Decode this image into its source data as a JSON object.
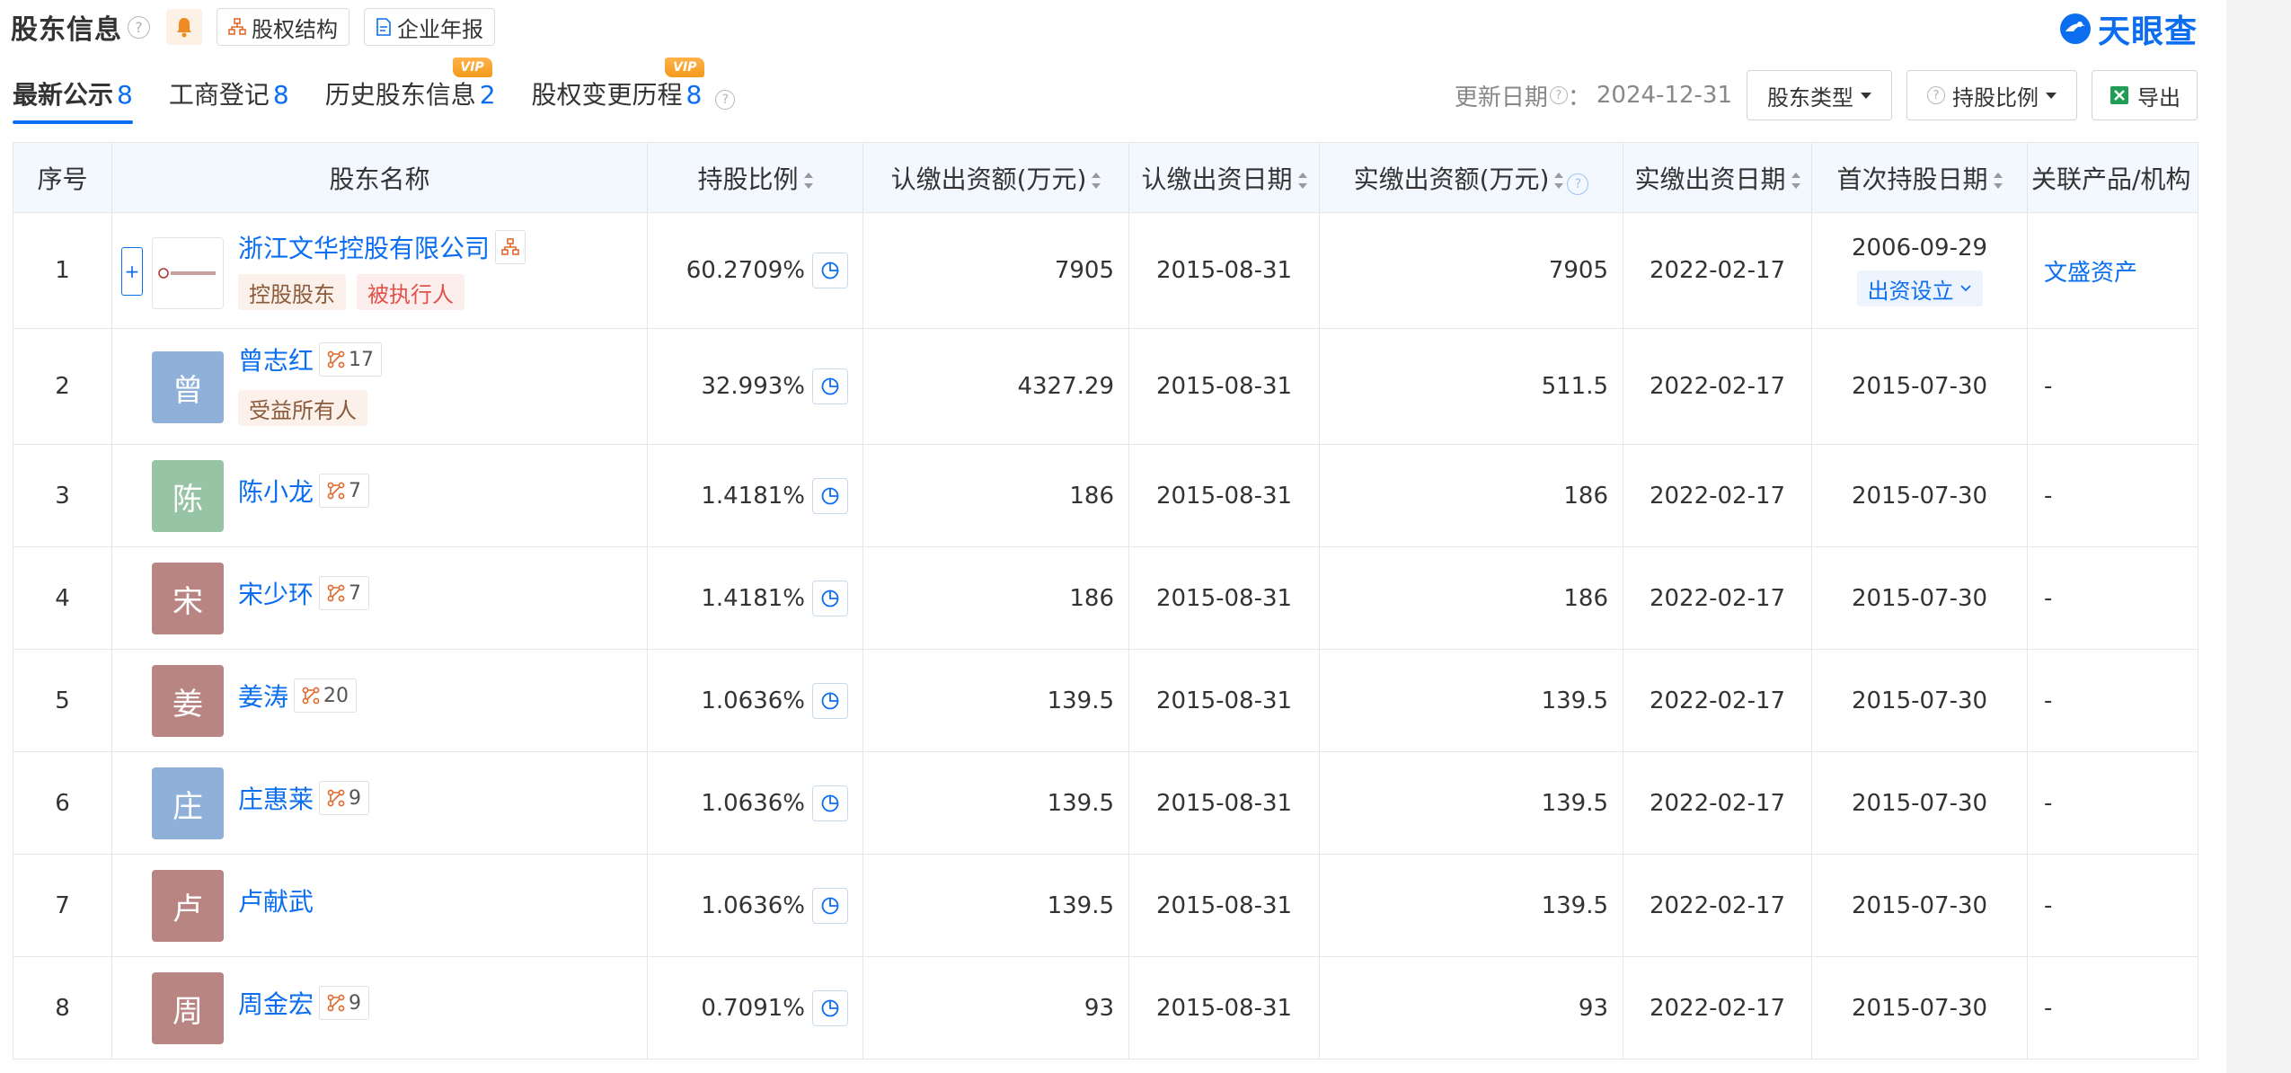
{
  "header": {
    "title": "股东信息",
    "help_mark": "?",
    "equity_structure_label": "股权结构",
    "annual_report_label": "企业年报",
    "logo_text": "天眼查"
  },
  "tabs": [
    {
      "label": "最新公示",
      "count": "8",
      "active": true
    },
    {
      "label": "工商登记",
      "count": "8",
      "active": false
    },
    {
      "label": "历史股东信息",
      "count": "2",
      "vip": "VIP"
    },
    {
      "label": "股权变更历程",
      "count": "8",
      "vip": "VIP",
      "help": "?"
    }
  ],
  "toolbar": {
    "update_label": "更新日期",
    "update_separator": "：",
    "update_date": "2024-12-31",
    "type_filter_label": "股东类型",
    "ratio_filter_label": "持股比例",
    "export_label": "导出"
  },
  "table": {
    "headers": [
      "序号",
      "股东名称",
      "持股比例",
      "认缴出资额(万元)",
      "认缴出资日期",
      "实缴出资额(万元)",
      "实缴出资日期",
      "首次持股日期",
      "关联产品/机构"
    ],
    "rows": [
      {
        "no": "1",
        "name": "浙江文华控股有限公司",
        "avatar": "",
        "tags": [
          "控股股东",
          "被执行人"
        ],
        "ratio": "60.2709%",
        "subscribed": "7905",
        "subscribed_date": "2015-08-31",
        "paid": "7905",
        "paid_date": "2022-02-17",
        "first_date": "2006-09-29",
        "first_action": "出资设立",
        "related": "文盛资产"
      },
      {
        "no": "2",
        "name": "曾志红",
        "avatar": "曾",
        "badge": "17",
        "tags": [
          "受益所有人"
        ],
        "ratio": "32.993%",
        "subscribed": "4327.29",
        "subscribed_date": "2015-08-31",
        "paid": "511.5",
        "paid_date": "2022-02-17",
        "first_date": "2015-07-30",
        "related": "-"
      },
      {
        "no": "3",
        "name": "陈小龙",
        "avatar": "陈",
        "badge": "7",
        "ratio": "1.4181%",
        "subscribed": "186",
        "subscribed_date": "2015-08-31",
        "paid": "186",
        "paid_date": "2022-02-17",
        "first_date": "2015-07-30",
        "related": "-"
      },
      {
        "no": "4",
        "name": "宋少环",
        "avatar": "宋",
        "badge": "7",
        "ratio": "1.4181%",
        "subscribed": "186",
        "subscribed_date": "2015-08-31",
        "paid": "186",
        "paid_date": "2022-02-17",
        "first_date": "2015-07-30",
        "related": "-"
      },
      {
        "no": "5",
        "name": "姜涛",
        "avatar": "姜",
        "badge": "20",
        "ratio": "1.0636%",
        "subscribed": "139.5",
        "subscribed_date": "2015-08-31",
        "paid": "139.5",
        "paid_date": "2022-02-17",
        "first_date": "2015-07-30",
        "related": "-"
      },
      {
        "no": "6",
        "name": "庄惠莱",
        "avatar": "庄",
        "badge": "9",
        "ratio": "1.0636%",
        "subscribed": "139.5",
        "subscribed_date": "2015-08-31",
        "paid": "139.5",
        "paid_date": "2022-02-17",
        "first_date": "2015-07-30",
        "related": "-"
      },
      {
        "no": "7",
        "name": "卢献武",
        "avatar": "卢",
        "ratio": "1.0636%",
        "subscribed": "139.5",
        "subscribed_date": "2015-08-31",
        "paid": "139.5",
        "paid_date": "2022-02-17",
        "first_date": "2015-07-30",
        "related": "-"
      },
      {
        "no": "8",
        "name": "周金宏",
        "avatar": "周",
        "badge": "9",
        "ratio": "0.7091%",
        "subscribed": "93",
        "subscribed_date": "2015-08-31",
        "paid": "93",
        "paid_date": "2022-02-17",
        "first_date": "2015-07-30",
        "related": "-"
      }
    ]
  },
  "colors": {
    "brand_blue": "#0b6ef0",
    "avatar_blue": "#8fb0d8",
    "avatar_green": "#96c4a4",
    "avatar_rose": "#b98583"
  },
  "icons": {
    "bell": "bell-icon",
    "equity": "org-chart-icon",
    "report": "document-icon",
    "pie": "pie-chart-icon",
    "relation": "relation-graph-icon",
    "excel": "excel-icon",
    "expand": "plus-icon"
  }
}
